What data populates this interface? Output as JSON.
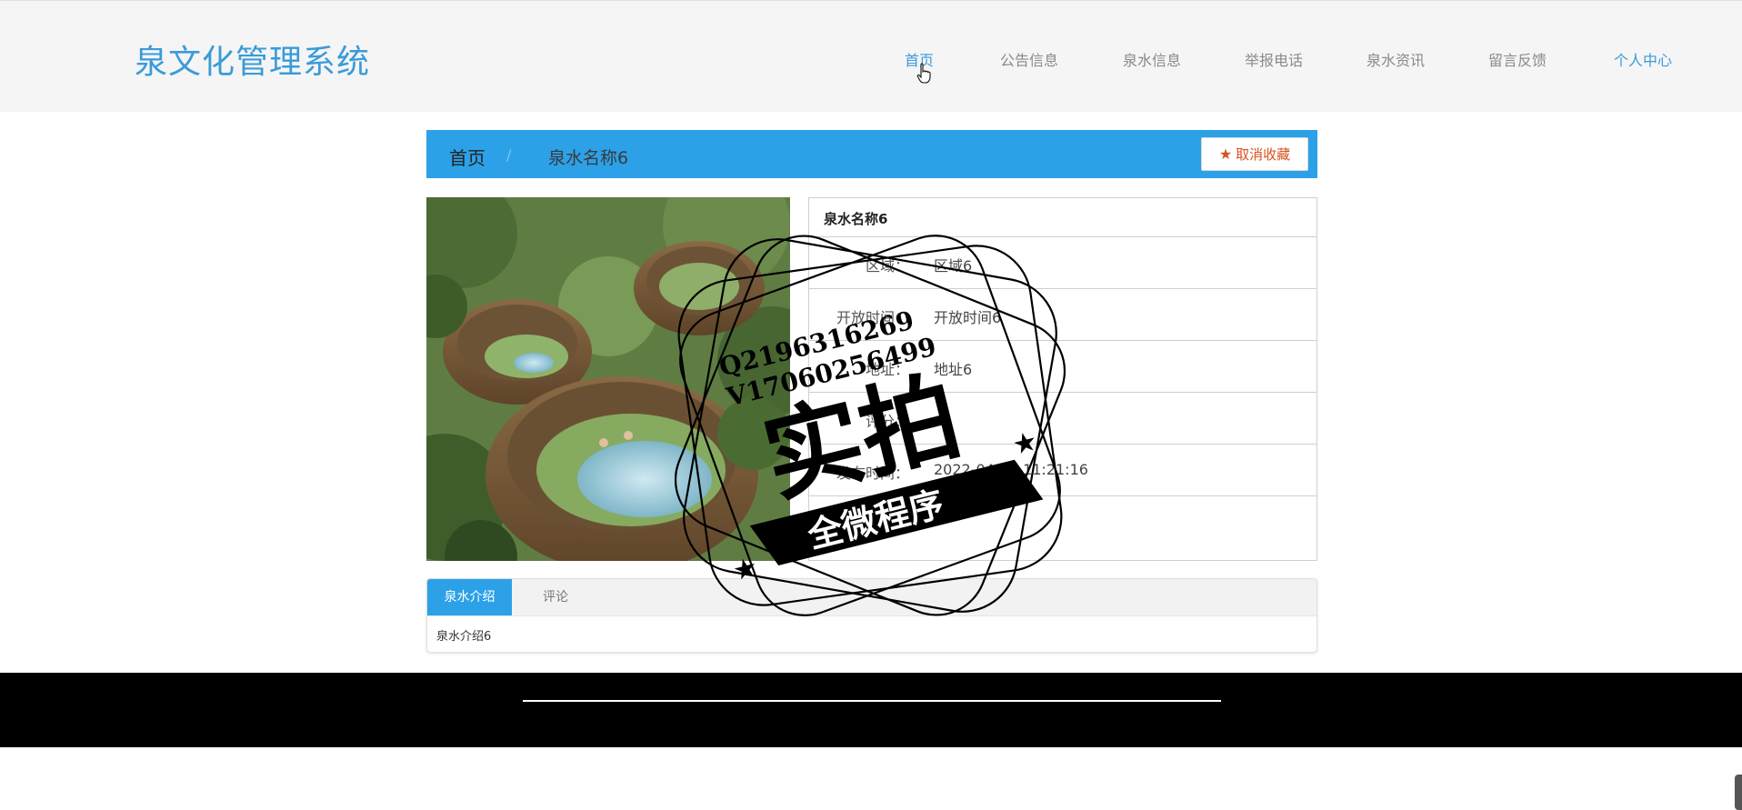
{
  "brand": "泉文化管理系统",
  "nav": [
    {
      "label": "首页",
      "active": true
    },
    {
      "label": "公告信息"
    },
    {
      "label": "泉水信息"
    },
    {
      "label": "举报电话"
    },
    {
      "label": "泉水资讯"
    },
    {
      "label": "留言反馈"
    },
    {
      "label": "个人中心"
    }
  ],
  "breadcrumb": {
    "home": "首页",
    "separator": "/",
    "current": "泉水名称6"
  },
  "favorite_button": "取消收藏",
  "detail": {
    "title": "泉水名称6",
    "rows": [
      {
        "label": "区域：",
        "value": "区域6"
      },
      {
        "label": "开放时间：",
        "value": "开放时间6"
      },
      {
        "label": "地址：",
        "value": "地址6"
      },
      {
        "label": "评分：",
        "value": ""
      },
      {
        "label": "发布时间：",
        "value": "2022-04-01 11:21:16"
      }
    ]
  },
  "tabs": [
    {
      "label": "泉水介绍",
      "active": true
    },
    {
      "label": "评论"
    }
  ],
  "tab_content": "泉水介绍6",
  "stamp": {
    "contact_q": "Q2196316269",
    "contact_v": "V17060256499",
    "big_text": "实拍",
    "banner": "全微程序"
  },
  "colors": {
    "brand": "#3a9bd9",
    "breadcrumb_bg": "#2ca1e8",
    "favorite": "#d9501f",
    "footer": "#000000"
  }
}
